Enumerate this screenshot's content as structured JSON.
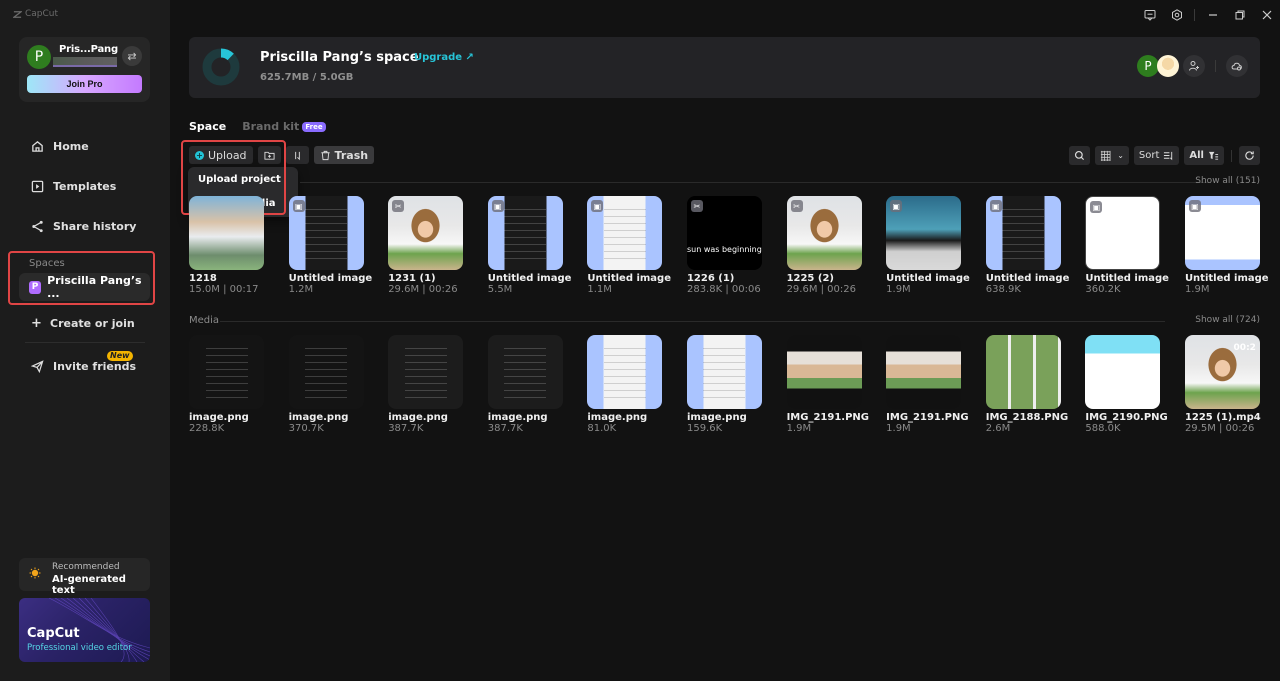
{
  "app": {
    "logo_text": "CapCut"
  },
  "sidebar": {
    "profile": {
      "avatar_letter": "P",
      "name": "Pris...Pang",
      "join_pro_label": "Join Pro"
    },
    "nav": [
      {
        "label": "Home",
        "icon": "home-icon"
      },
      {
        "label": "Templates",
        "icon": "templates-icon"
      },
      {
        "label": "Share history",
        "icon": "share-icon"
      }
    ],
    "spaces_label": "Spaces",
    "space_item": {
      "badge": "P",
      "label": "Priscilla Pang’s ..."
    },
    "create_join_label": "Create or join",
    "invite": {
      "label": "Invite friends",
      "badge": "New"
    },
    "recommended": {
      "caption": "Recommended",
      "title": "AI-generated text"
    },
    "promo": {
      "title": "CapCut",
      "subtitle": "Professional video editor"
    }
  },
  "header": {
    "title": "Priscilla Pang’s space",
    "upgrade_label": "Upgrade ↗",
    "storage_text": "625.7MB / 5.0GB",
    "storage_used_fraction": 0.122,
    "member_avatar_letter": "P",
    "accent_color": "#27c5d8"
  },
  "tabs": [
    {
      "label": "Space",
      "active": true
    },
    {
      "label": "Brand kit",
      "active": false,
      "badge": "Free"
    }
  ],
  "toolbar": {
    "upload_label": "Upload",
    "trash_label": "Trash",
    "dropdown": [
      "Upload project",
      "Upload media"
    ],
    "sort_label": "Sort",
    "filter_label": "All"
  },
  "projects": {
    "show_all": "Show all (151)",
    "items": [
      {
        "name": "1218",
        "meta": "15.0M | 00:17",
        "thumb": "t-photo",
        "badge": ""
      },
      {
        "name": "Untitled image",
        "meta": "1.2M",
        "thumb": "t-phone-blue",
        "badge": "img"
      },
      {
        "name": "1231 (1)",
        "meta": "29.6M | 00:26",
        "thumb": "t-girl",
        "badge": "cut"
      },
      {
        "name": "Untitled image",
        "meta": "5.5M",
        "thumb": "t-phone-blue",
        "badge": "img"
      },
      {
        "name": "Untitled image",
        "meta": "1.1M",
        "thumb": "t-phone-white",
        "badge": "img"
      },
      {
        "name": "1226 (1)",
        "meta": "283.8K | 00:06",
        "thumb": "t-black",
        "badge": "cut",
        "caption": "sun was beginning t"
      },
      {
        "name": "1225 (2)",
        "meta": "29.6M | 00:26",
        "thumb": "t-girl",
        "badge": "cut"
      },
      {
        "name": "Untitled image",
        "meta": "1.9M",
        "thumb": "t-alaska",
        "badge": "img"
      },
      {
        "name": "Untitled image",
        "meta": "638.9K",
        "thumb": "t-phone-blue",
        "badge": "img"
      },
      {
        "name": "Untitled image",
        "meta": "360.2K",
        "thumb": "t-web",
        "badge": "img"
      },
      {
        "name": "Untitled image",
        "meta": "1.9M",
        "thumb": "t-web2",
        "badge": "img"
      }
    ]
  },
  "media": {
    "label": "Media",
    "show_all": "Show all (724)",
    "items": [
      {
        "name": "image.png",
        "meta": "228.8K",
        "thumb": "t-dark"
      },
      {
        "name": "image.png",
        "meta": "370.7K",
        "thumb": "t-dark"
      },
      {
        "name": "image.png",
        "meta": "387.7K",
        "thumb": "t-dark2"
      },
      {
        "name": "image.png",
        "meta": "387.7K",
        "thumb": "t-dark2"
      },
      {
        "name": "image.png",
        "meta": "81.0K",
        "thumb": "t-phone-white"
      },
      {
        "name": "image.png",
        "meta": "159.6K",
        "thumb": "t-phone-white"
      },
      {
        "name": "IMG_2191.PNG",
        "meta": "1.9M",
        "thumb": "t-vid"
      },
      {
        "name": "IMG_2191.PNG",
        "meta": "1.9M",
        "thumb": "t-vid"
      },
      {
        "name": "IMG_2188.PNG",
        "meta": "2.6M",
        "thumb": "t-grid"
      },
      {
        "name": "IMG_2190.PNG",
        "meta": "588.0K",
        "thumb": "t-proj"
      },
      {
        "name": "1225 (1).mp4",
        "meta": "29.5M | 00:26",
        "thumb": "t-girl",
        "timecode": "00:2"
      }
    ]
  }
}
